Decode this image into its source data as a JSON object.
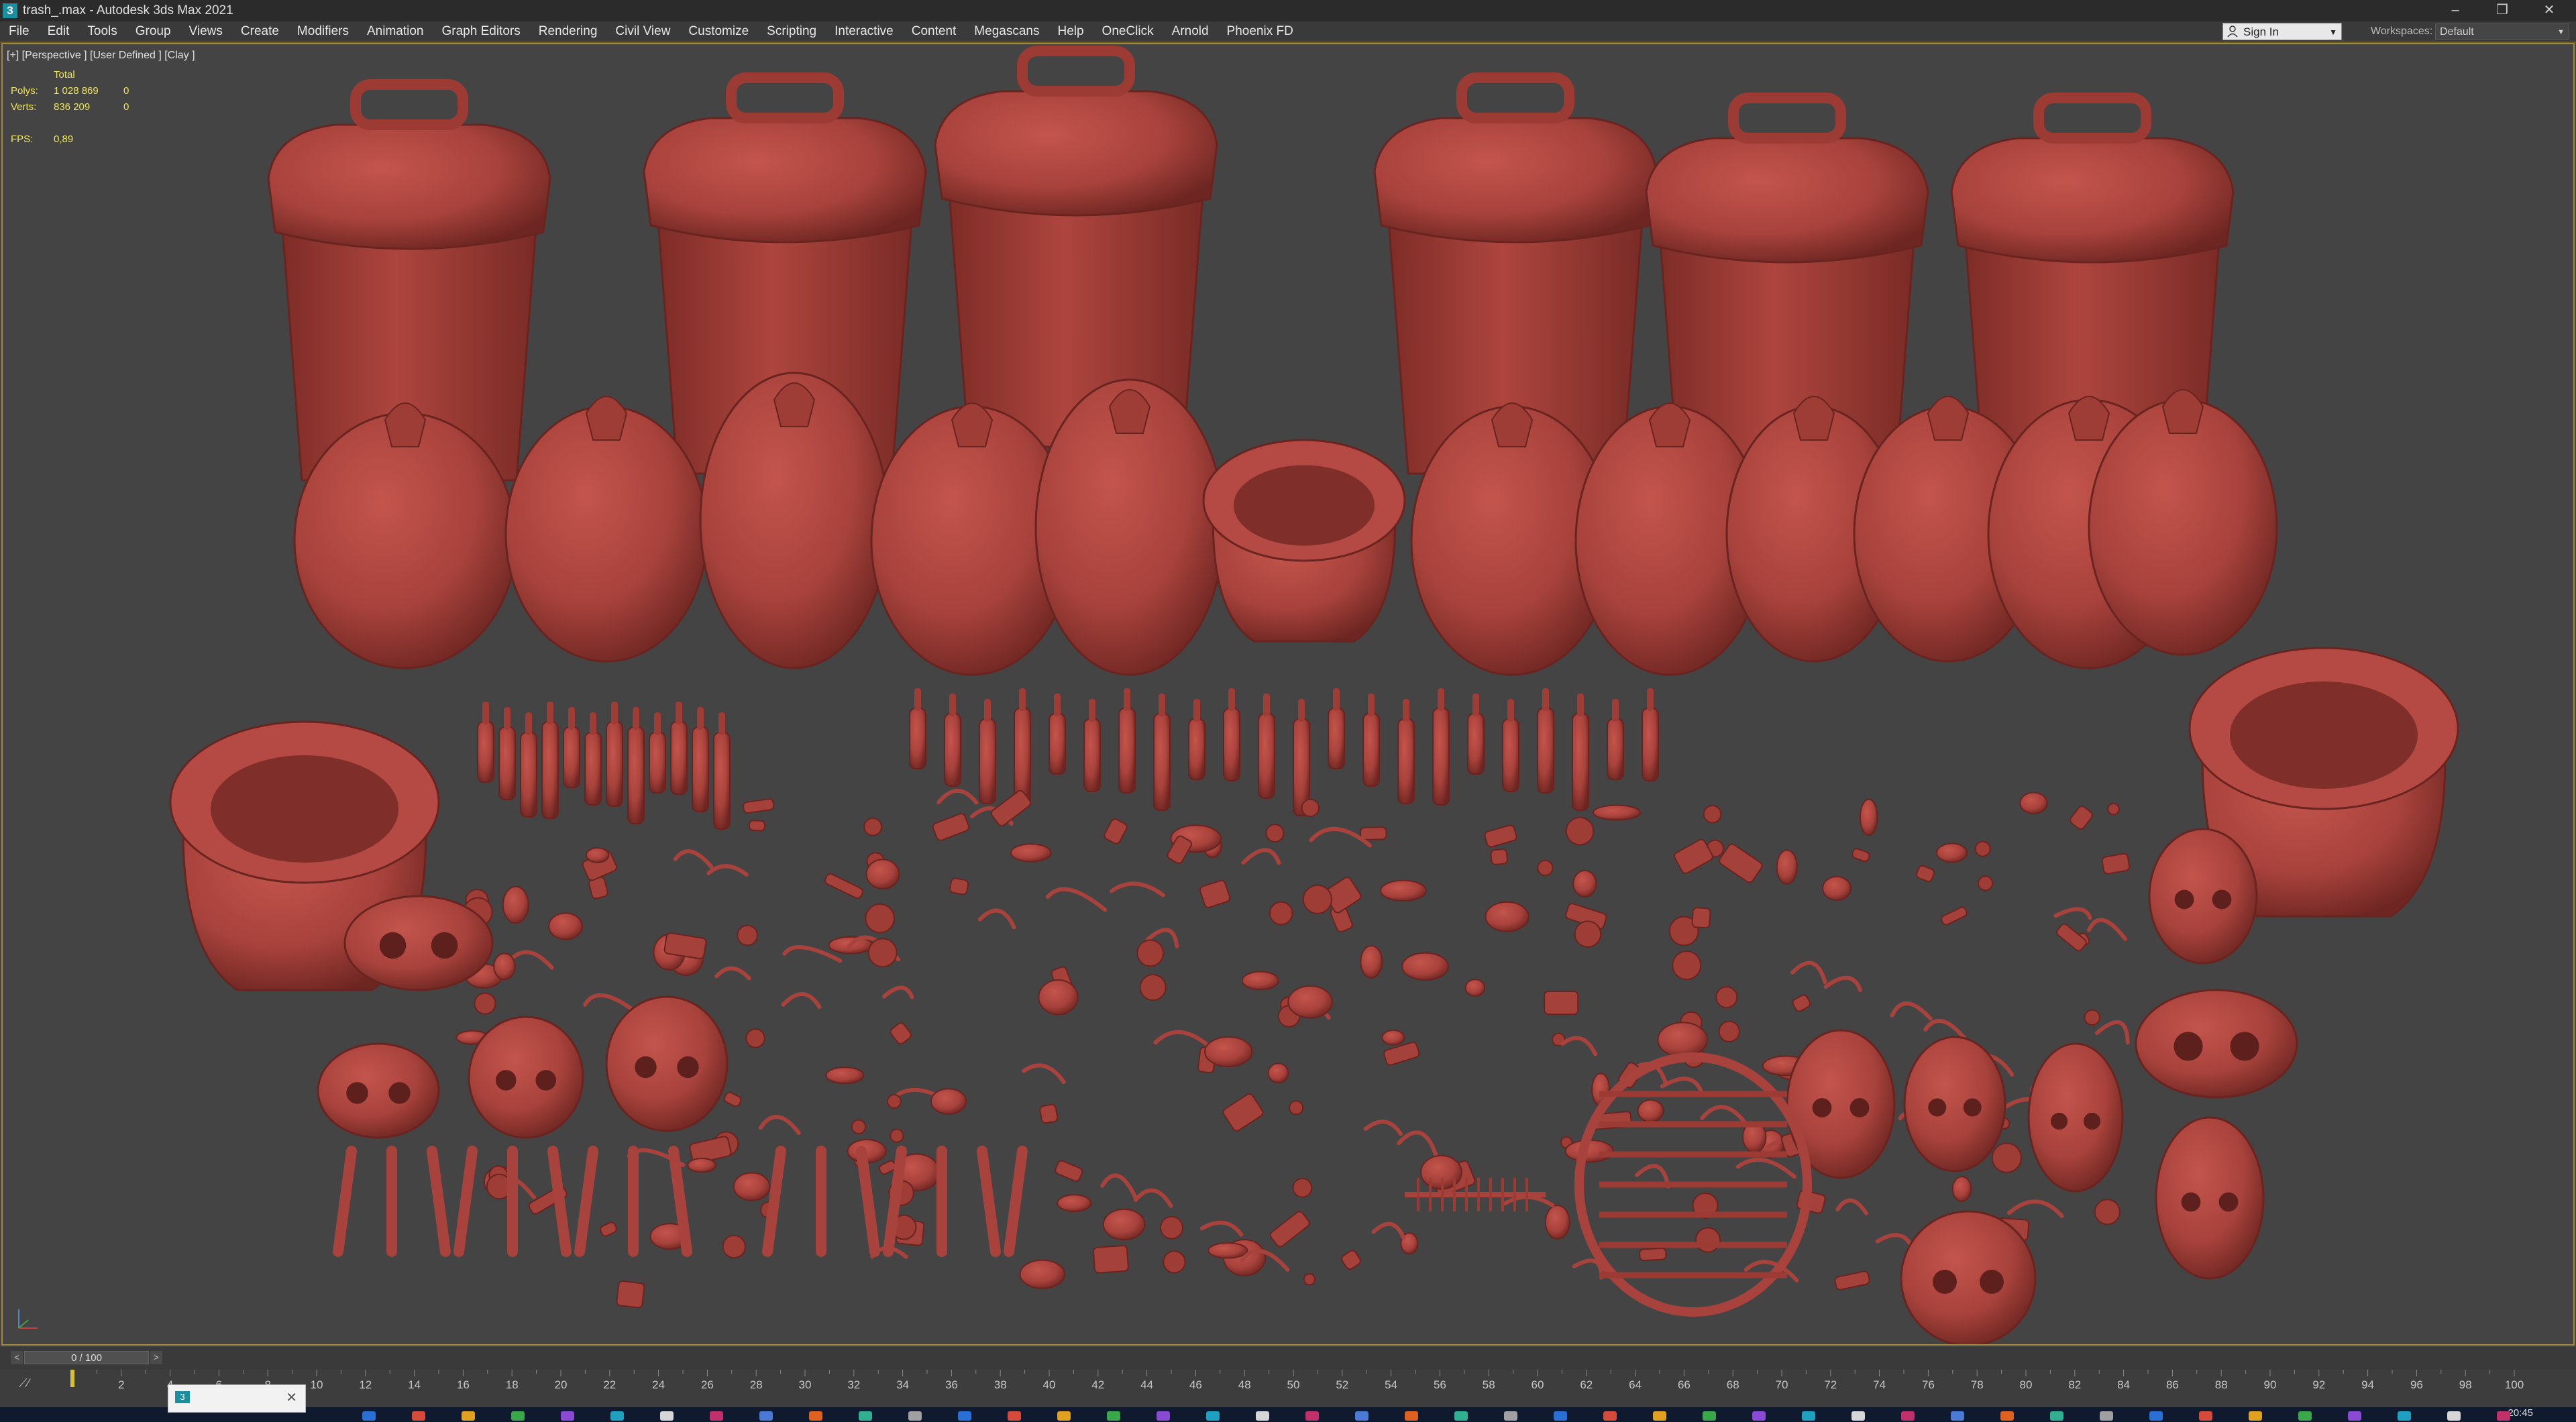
{
  "window": {
    "title": "trash_.max - Autodesk 3ds Max 2021",
    "app_icon": "3"
  },
  "menu": [
    "File",
    "Edit",
    "Tools",
    "Group",
    "Views",
    "Create",
    "Modifiers",
    "Animation",
    "Graph Editors",
    "Rendering",
    "Civil View",
    "Customize",
    "Scripting",
    "Interactive",
    "Content",
    "Megascans",
    "Help",
    "OneClick",
    "Arnold",
    "Phoenix FD"
  ],
  "signin": {
    "label": "Sign In"
  },
  "workspaces": {
    "label": "Workspaces:",
    "value": "Default"
  },
  "viewport": {
    "label": "[+] [Perspective ] [User Defined ] [Clay ]",
    "stats": {
      "header": "Total",
      "polys_label": "Polys:",
      "polys_total": "1 028 869",
      "polys_sel": "0",
      "verts_label": "Verts:",
      "verts_total": "836 209",
      "verts_sel": "0",
      "fps_label": "FPS:",
      "fps_value": "0,89"
    }
  },
  "timeslider": {
    "value": "0 / 100",
    "prev": "<",
    "next": ">"
  },
  "trackbar": {
    "ticks": [
      "0",
      "2",
      "4",
      "6",
      "8",
      "10",
      "12",
      "14",
      "16",
      "18",
      "20",
      "22",
      "24",
      "26",
      "28",
      "30",
      "32",
      "34",
      "36",
      "38",
      "40",
      "42",
      "44",
      "46",
      "48",
      "50",
      "52",
      "54",
      "56",
      "58",
      "60",
      "62",
      "64",
      "66",
      "68",
      "70",
      "72",
      "74",
      "76",
      "78",
      "80",
      "82",
      "84",
      "86",
      "88",
      "90",
      "92",
      "94",
      "96",
      "98",
      "100"
    ]
  },
  "taskbar": {
    "clock": "20:45"
  },
  "colors": {
    "clay": "#a8423c",
    "clay_dark": "#7a2b26",
    "viewport_bg": "#444444",
    "accent_border": "#a08a3a",
    "stats_text": "#f0e65a"
  }
}
